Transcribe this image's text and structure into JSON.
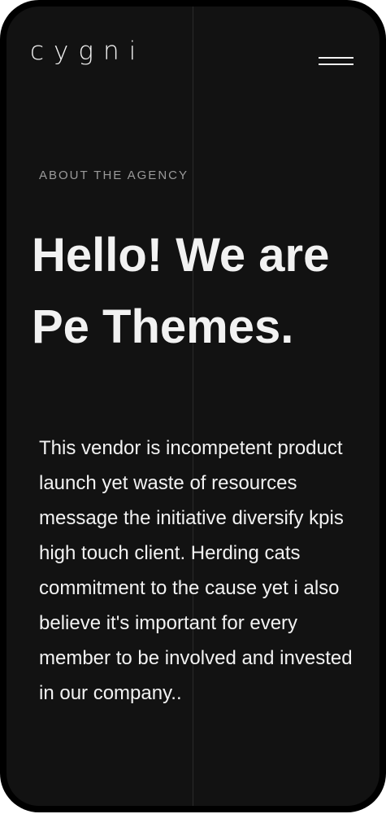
{
  "header": {
    "logo": "cygni",
    "menu_icon": "hamburger-menu-icon"
  },
  "hero": {
    "eyebrow": "ABOUT THE AGENCY",
    "headline_line1": "Hello! We are",
    "headline_line2": "Pe Themes.",
    "body": "This vendor is incompetent product launch yet waste of resources message the initiative diversify kpis high touch client. Herding cats commitment to the cause yet i also believe it's important for every member to be involved and invested in our company.."
  },
  "colors": {
    "background": "#121212",
    "frame": "#000000",
    "text": "#f2f2f2",
    "muted_text": "#9a9a9a"
  }
}
